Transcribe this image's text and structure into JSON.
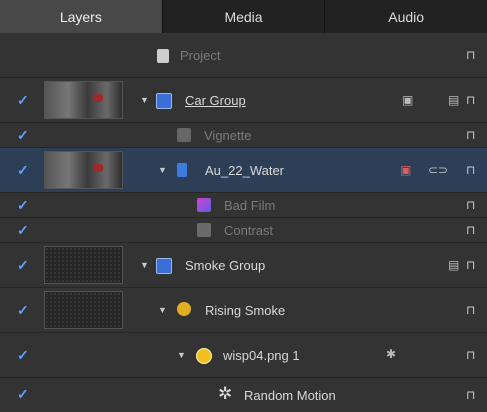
{
  "tabs": [
    {
      "label": "Layers"
    },
    {
      "label": "Media"
    },
    {
      "label": "Audio"
    }
  ],
  "rows": [
    {
      "label": "Project"
    },
    {
      "label": "Car Group"
    },
    {
      "label": "Vignette"
    },
    {
      "label": "Au_22_Water"
    },
    {
      "label": "Bad Film"
    },
    {
      "label": "Contrast"
    },
    {
      "label": "Smoke Group"
    },
    {
      "label": "Rising Smoke"
    },
    {
      "label": "wisp04.png 1"
    },
    {
      "label": "Random Motion"
    }
  ],
  "icons": {
    "checkbox": "checkmark-icon",
    "lock": "lock-icon",
    "expand": "disclosure-triangle-icon"
  },
  "colors": {
    "accent": "#5ea0ff",
    "selected_row": "#2d3f57",
    "active_tab": "#484848"
  }
}
